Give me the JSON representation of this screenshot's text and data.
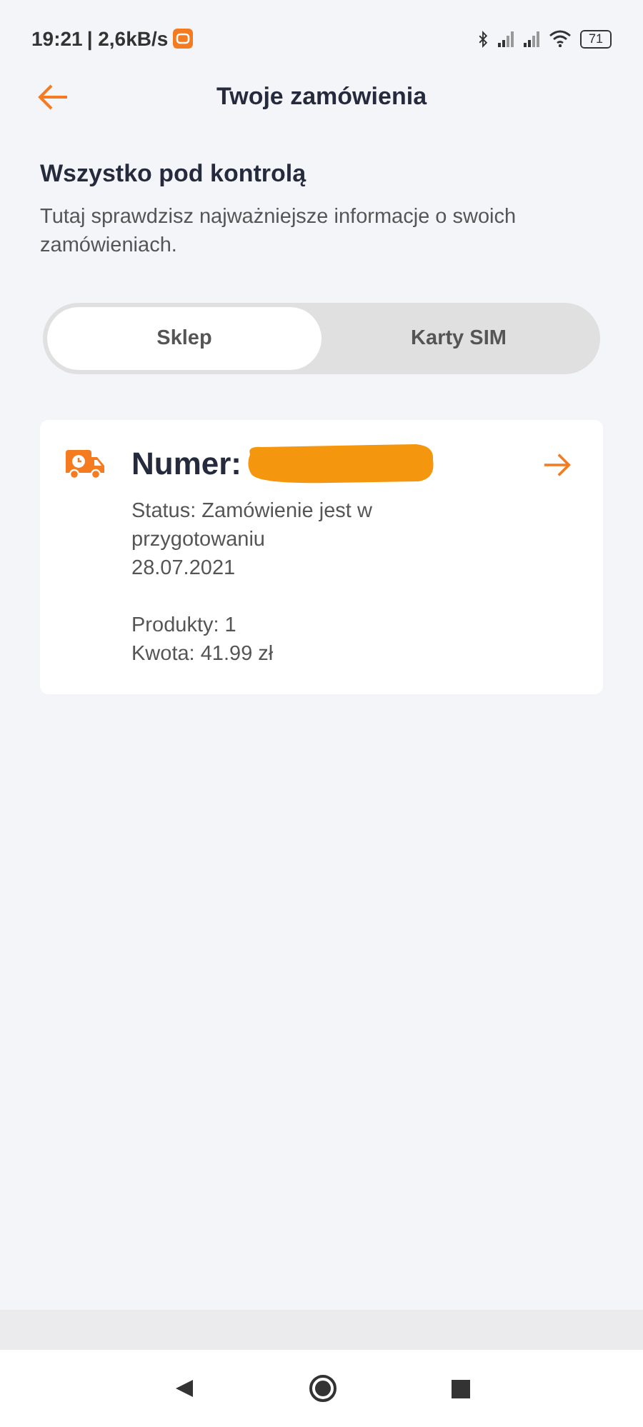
{
  "status_bar": {
    "time": "19:21",
    "speed": "| 2,6kB/s",
    "battery": "71"
  },
  "header": {
    "title": "Twoje zamówienia"
  },
  "intro": {
    "heading": "Wszystko pod kontrolą",
    "text": "Tutaj sprawdzisz najważniejsze informacje o swoich zamówieniach."
  },
  "tabs": [
    {
      "label": "Sklep",
      "selected": true
    },
    {
      "label": "Karty SIM",
      "selected": false
    }
  ],
  "orders": [
    {
      "number_label": "Numer:",
      "status": "Status: Zamówienie jest w przygotowaniu",
      "date": "28.07.2021",
      "products": "Produkty: 1",
      "amount": "Kwota: 41.99 zł"
    }
  ]
}
